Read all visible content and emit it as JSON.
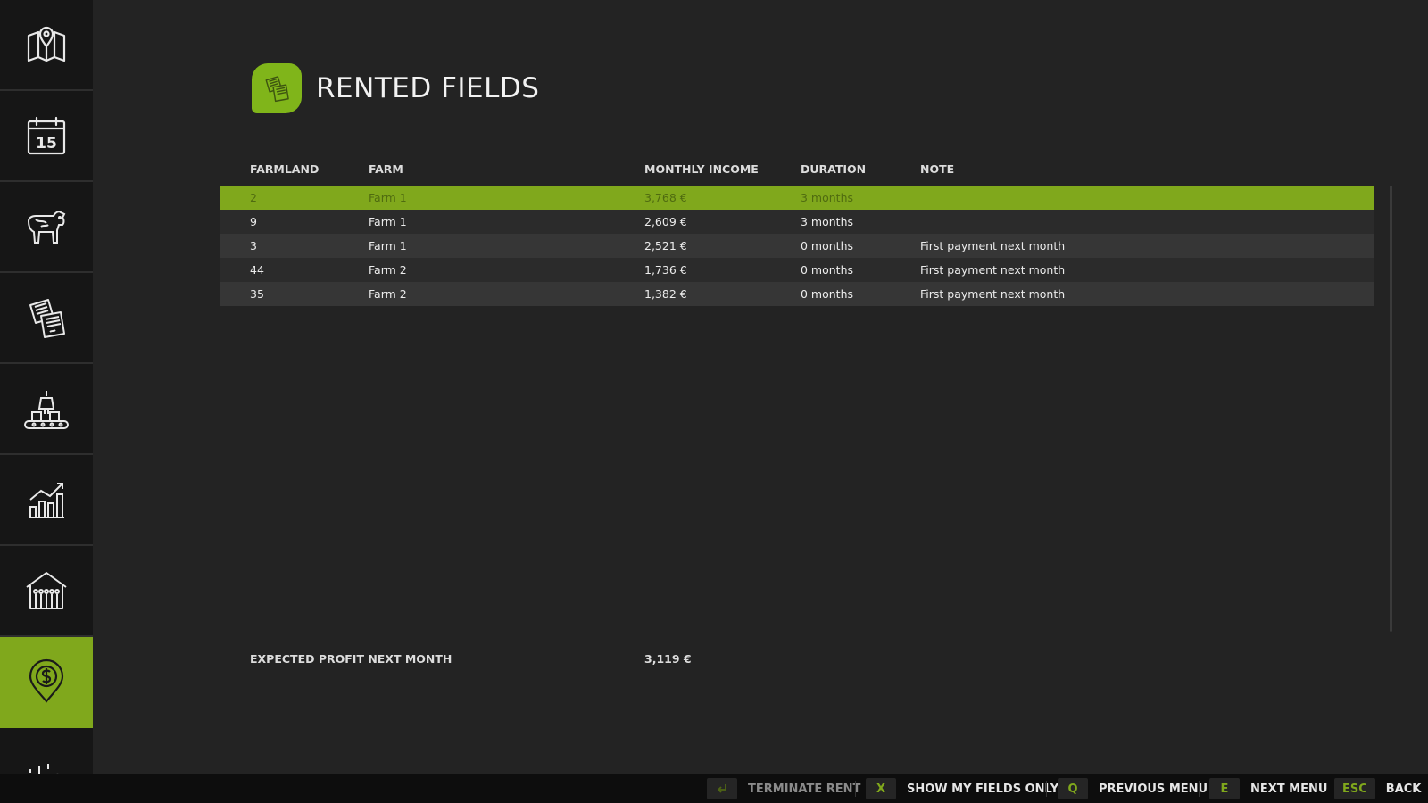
{
  "sidebar": {
    "items": [
      {
        "icon": "map-icon",
        "active": false
      },
      {
        "icon": "calendar-icon",
        "day": "15",
        "active": false
      },
      {
        "icon": "cow-icon",
        "active": false
      },
      {
        "icon": "documents-icon",
        "active": false
      },
      {
        "icon": "production-icon",
        "active": false
      },
      {
        "icon": "statistics-icon",
        "active": false
      },
      {
        "icon": "barn-icon",
        "active": false
      },
      {
        "icon": "money-location-icon",
        "active": true
      },
      {
        "icon": "settings-icon",
        "active": false
      }
    ],
    "accent": "#80a81c"
  },
  "header": {
    "icon": "documents-icon",
    "title": "RENTED FIELDS"
  },
  "table": {
    "columns": [
      "FARMLAND",
      "FARM",
      "MONTHLY INCOME",
      "DURATION",
      "NOTE"
    ],
    "rows": [
      {
        "farmland": "2",
        "farm": "Farm 1",
        "income": "3,768 €",
        "duration": "3 months",
        "note": ""
      },
      {
        "farmland": "9",
        "farm": "Farm 1",
        "income": "2,609 €",
        "duration": "3 months",
        "note": ""
      },
      {
        "farmland": "3",
        "farm": "Farm 1",
        "income": "2,521 €",
        "duration": "0 months",
        "note": "First payment next month"
      },
      {
        "farmland": "44",
        "farm": "Farm 2",
        "income": "1,736 €",
        "duration": "0 months",
        "note": "First payment next month"
      },
      {
        "farmland": "35",
        "farm": "Farm 2",
        "income": "1,382 €",
        "duration": "0 months",
        "note": "First payment next month"
      }
    ],
    "selected_index": 0
  },
  "summary": {
    "label": "EXPECTED PROFIT NEXT MONTH",
    "value": "3,119 €"
  },
  "bottombar": {
    "terminate": {
      "key_icon": "enter-icon",
      "label": "TERMINATE RENT",
      "disabled": true
    },
    "show_my": {
      "key": "X",
      "label": "SHOW MY FIELDS ONLY"
    },
    "prev": {
      "key": "Q",
      "label": "PREVIOUS MENU"
    },
    "next": {
      "key": "E",
      "label": "NEXT MENU"
    },
    "back": {
      "key": "ESC",
      "label": "BACK"
    }
  }
}
